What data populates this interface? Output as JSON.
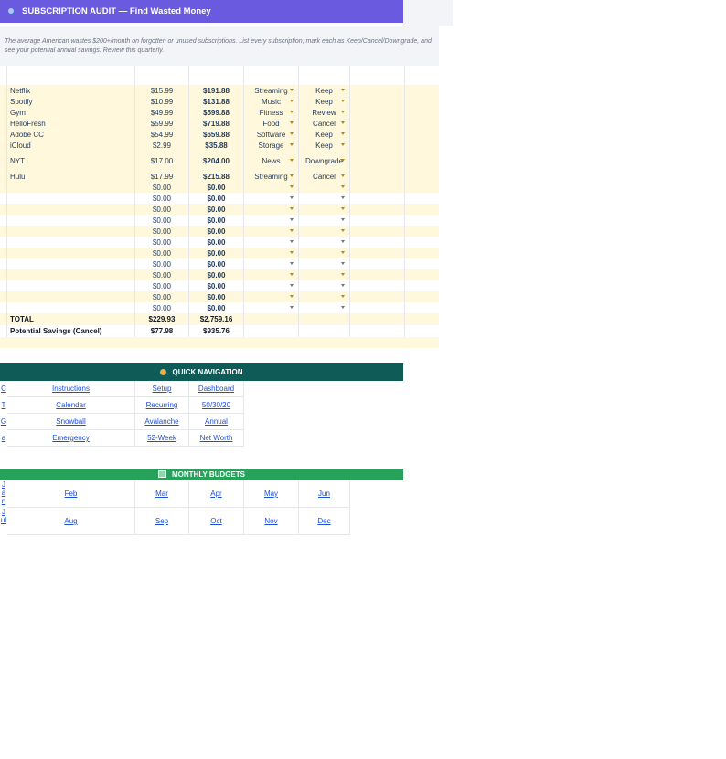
{
  "header": {
    "title": "SUBSCRIPTION AUDIT — Find Wasted Money",
    "intro": "The average American wastes $200+/month on forgotten or unused subscriptions. List every subscription, mark each as Keep/Cancel/Downgrade, and see your potential annual savings. Review this quarterly."
  },
  "subscriptions": [
    {
      "name": "Netflix",
      "monthly": "$15.99",
      "annual": "$191.88",
      "category": "Streaming",
      "action": "Keep"
    },
    {
      "name": "Spotify",
      "monthly": "$10.99",
      "annual": "$131.88",
      "category": "Music",
      "action": "Keep"
    },
    {
      "name": "Gym",
      "monthly": "$49.99",
      "annual": "$599.88",
      "category": "Fitness",
      "action": "Review"
    },
    {
      "name": "HelloFresh",
      "monthly": "$59.99",
      "annual": "$719.88",
      "category": "Food",
      "action": "Cancel"
    },
    {
      "name": "Adobe CC",
      "monthly": "$54.99",
      "annual": "$659.88",
      "category": "Software",
      "action": "Keep"
    },
    {
      "name": "iCloud",
      "monthly": "$2.99",
      "annual": "$35.88",
      "category": "Storage",
      "action": "Keep"
    },
    {
      "name": "NYT",
      "monthly": "$17.00",
      "annual": "$204.00",
      "category": "News",
      "action": "Downgrade"
    },
    {
      "name": "Hulu",
      "monthly": "$17.99",
      "annual": "$215.88",
      "category": "Streaming",
      "action": "Cancel"
    }
  ],
  "empty_rows": [
    {
      "monthly": "$0.00",
      "annual": "$0.00"
    },
    {
      "monthly": "$0.00",
      "annual": "$0.00"
    },
    {
      "monthly": "$0.00",
      "annual": "$0.00"
    },
    {
      "monthly": "$0.00",
      "annual": "$0.00"
    },
    {
      "monthly": "$0.00",
      "annual": "$0.00"
    },
    {
      "monthly": "$0.00",
      "annual": "$0.00"
    },
    {
      "monthly": "$0.00",
      "annual": "$0.00"
    },
    {
      "monthly": "$0.00",
      "annual": "$0.00"
    },
    {
      "monthly": "$0.00",
      "annual": "$0.00"
    },
    {
      "monthly": "$0.00",
      "annual": "$0.00"
    },
    {
      "monthly": "$0.00",
      "annual": "$0.00"
    },
    {
      "monthly": "$0.00",
      "annual": "$0.00"
    }
  ],
  "totals": {
    "total_label": "TOTAL",
    "total_monthly": "$229.93",
    "total_annual": "$2,759.16",
    "savings_label": "Potential Savings (Cancel)",
    "savings_monthly": "$77.98",
    "savings_annual": "$935.76"
  },
  "navigation": {
    "title": "QUICK NAVIGATION",
    "side_links": [
      "C",
      "T",
      "G",
      "a"
    ],
    "links": [
      [
        "Instructions",
        "Setup",
        "Dashboard"
      ],
      [
        "Calendar",
        "Recurring",
        "50/30/20"
      ],
      [
        "Snowball",
        "Avalanche",
        "Annual"
      ],
      [
        "Emergency",
        "52-Week",
        "Net Worth"
      ]
    ]
  },
  "budgets": {
    "title": "MONTHLY BUDGETS",
    "side_links": [
      "Jan",
      "Jul"
    ],
    "row1": [
      "Feb",
      "Mar",
      "Apr",
      "May",
      "Jun"
    ],
    "row2": [
      "Aug",
      "Sep",
      "Oct",
      "Nov",
      "Dec"
    ]
  },
  "colors": {
    "header": "#6a5ae0",
    "nav_bar": "#0f5b57",
    "budget_bar": "#27a25b",
    "row_alt": "#fff8dc",
    "link": "#1d4ed8"
  }
}
